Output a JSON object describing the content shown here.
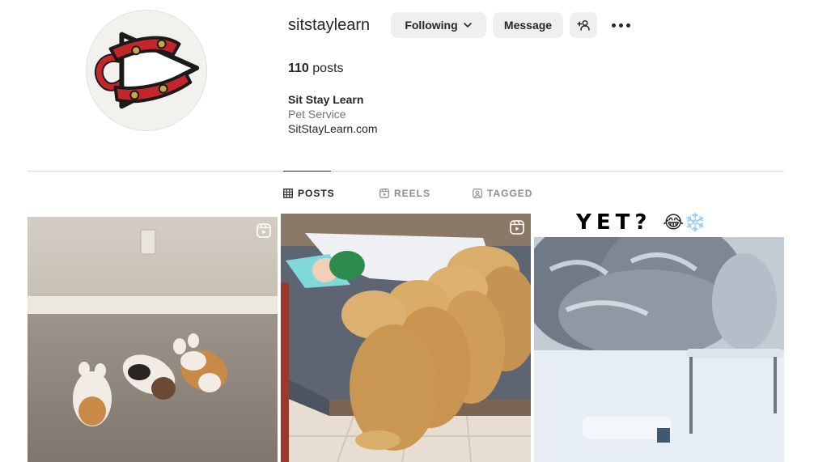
{
  "profile": {
    "username": "sitstaylearn",
    "following_label": "Following",
    "message_label": "Message",
    "suggest_icon": "add-person-icon",
    "more_icon": "more-dots-icon",
    "posts_count": "110",
    "posts_label": "posts",
    "full_name": "Sit Stay Learn",
    "category": "Pet Service",
    "website": "SitStayLearn.com"
  },
  "tabs": [
    {
      "label": "POSTS",
      "icon": "grid-icon",
      "active": true
    },
    {
      "label": "REELS",
      "icon": "reels-icon",
      "active": false
    },
    {
      "label": "TAGGED",
      "icon": "tagged-icon",
      "active": false
    }
  ],
  "grid": {
    "tile3_caption": "YET?",
    "tile3_emojis": "😂❄️"
  },
  "colors": {
    "button_bg": "#efefef",
    "text_primary": "#262626",
    "text_secondary": "#737373",
    "tab_inactive": "#8e8e8e",
    "divider": "#dbdbdb",
    "logo_red": "#c4262a"
  }
}
